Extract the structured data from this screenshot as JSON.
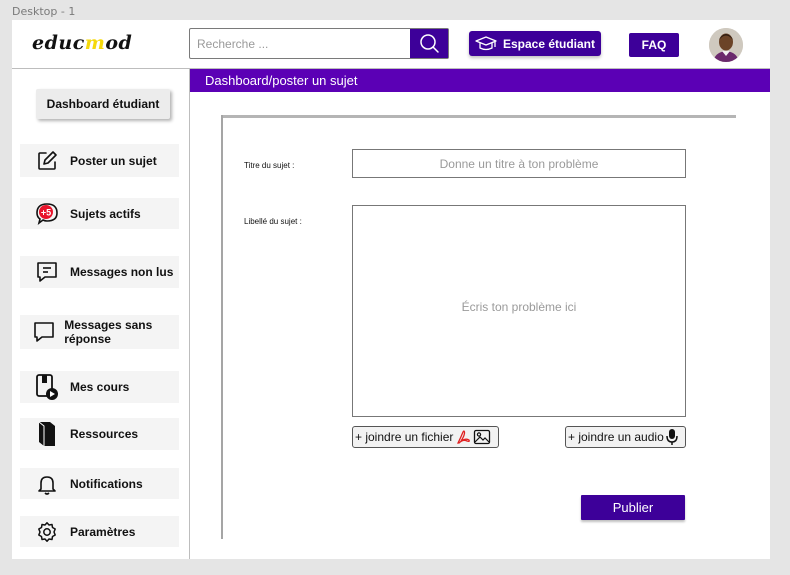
{
  "frame": {
    "label": "Desktop - 1"
  },
  "header": {
    "logo": {
      "part1": "educ",
      "part2": "m",
      "part3": "od"
    },
    "search": {
      "placeholder": "Recherche ..."
    },
    "student_space_label": "Espace étudiant",
    "faq_label": "FAQ"
  },
  "sidebar": {
    "dashboard_label": "Dashboard étudiant",
    "items": [
      {
        "label": "Poster un sujet",
        "icon": "edit-icon"
      },
      {
        "label": "Sujets actifs",
        "icon": "active-topics-icon",
        "badge": "+5"
      },
      {
        "label": "Messages non lus",
        "icon": "message-unread-icon"
      },
      {
        "label": "Messages sans réponse",
        "icon": "message-empty-icon"
      },
      {
        "label": "Mes cours",
        "icon": "courses-icon"
      },
      {
        "label": "Ressources",
        "icon": "book-icon"
      },
      {
        "label": "Notifications",
        "icon": "bell-icon"
      },
      {
        "label": "Paramètres",
        "icon": "gear-icon"
      }
    ]
  },
  "main": {
    "breadcrumb": "Dashboard/poster un sujet",
    "title_label": "Titre du sujet :",
    "title_placeholder": "Donne un titre à ton problème",
    "desc_label": "Libellé du sujet :",
    "desc_placeholder": "Écris ton problème ici",
    "attach_file_label": "+ joindre un fichier",
    "attach_audio_label": "+ joindre un audio",
    "publish_label": "Publier"
  },
  "colors": {
    "accent": "#3d0099",
    "breadcrumb_bg": "#5b00b5",
    "logo_highlight": "#f5d90a",
    "badge": "#e8142b"
  }
}
